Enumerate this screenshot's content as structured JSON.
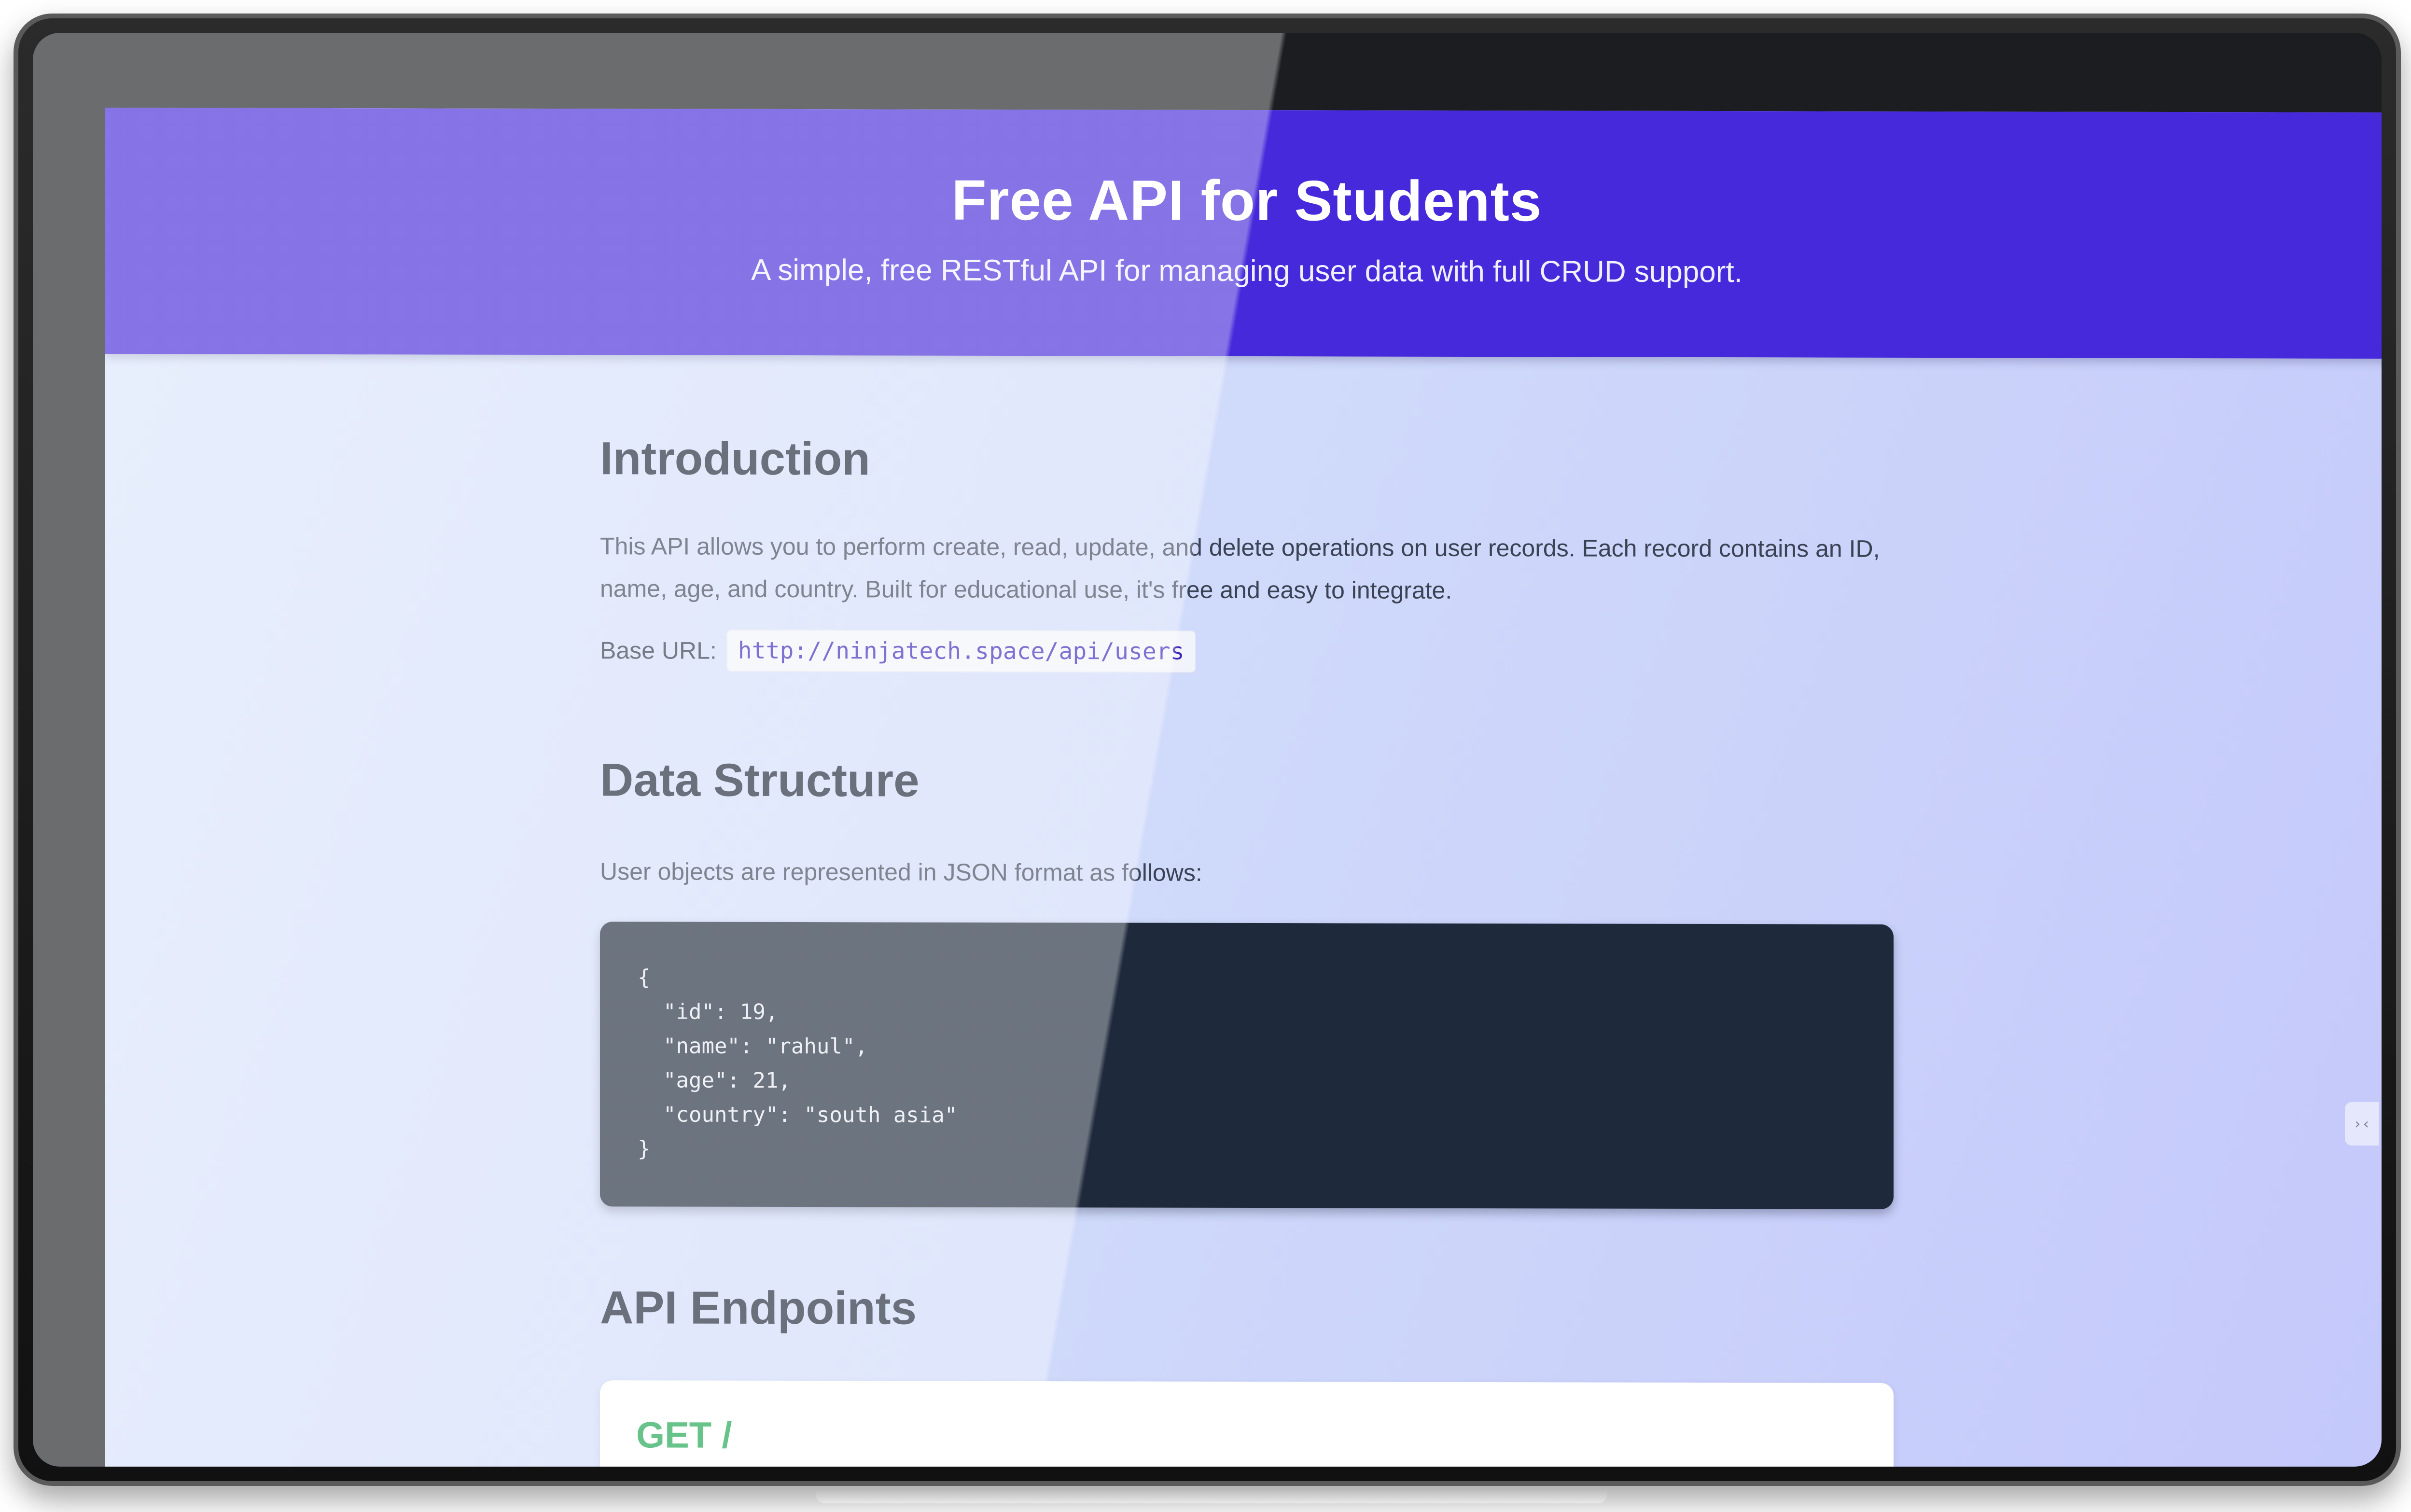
{
  "hero": {
    "title": "Free API for Students",
    "subtitle": "A simple, free RESTful API for managing user data with full CRUD support."
  },
  "introduction": {
    "heading": "Introduction",
    "paragraph": "This API allows you to perform create, read, update, and delete operations on user records. Each record contains an ID, name, age, and country. Built for educational use, it's free and easy to integrate.",
    "base_url_label": "Base URL:",
    "base_url": "http://ninjatech.space/api/users"
  },
  "data_structure": {
    "heading": "Data Structure",
    "paragraph": "User objects are represented in JSON format as follows:",
    "code": "{\n  \"id\": 19,\n  \"name\": \"rahul\",\n  \"age\": 21,\n  \"country\": \"south asia\"\n}"
  },
  "endpoints": {
    "heading": "API Endpoints",
    "items": [
      {
        "method_path": "GET /"
      }
    ]
  },
  "side_widget": {
    "icon": "collapse-arrows-icon",
    "glyph": "›‹"
  },
  "colors": {
    "hero_bg": "#4629da",
    "code_bg": "#1e293b",
    "get_method": "#16a34a",
    "inline_code_text": "#3b23b8"
  }
}
